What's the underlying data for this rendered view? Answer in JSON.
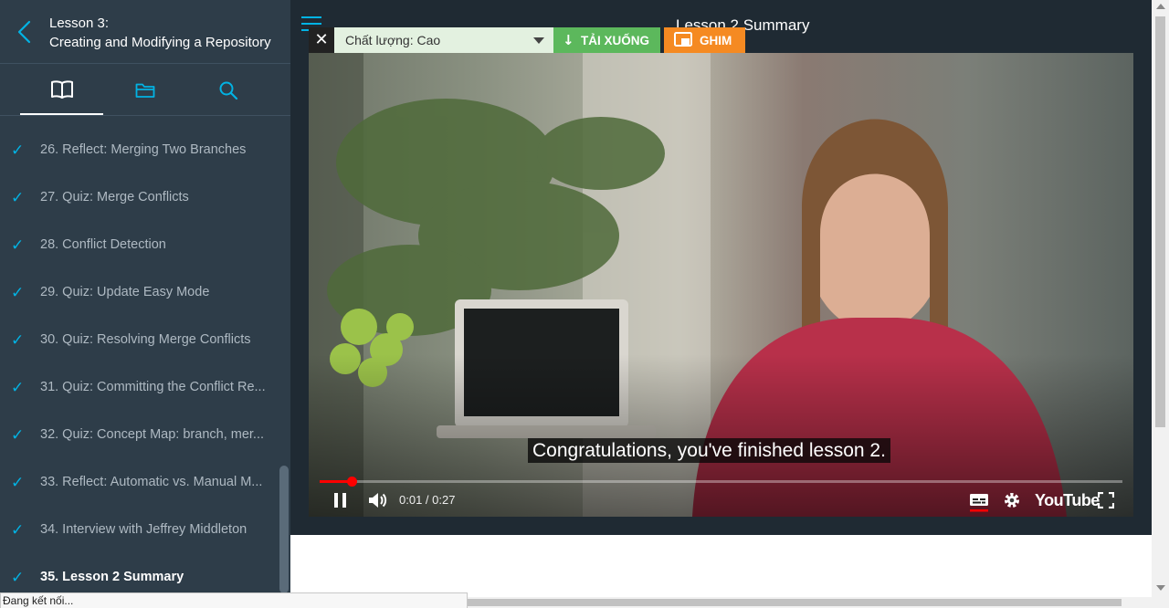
{
  "sidebar": {
    "lesson_number": "Lesson 3:",
    "lesson_title": "Creating and Modifying a Repository",
    "tabs": [
      {
        "icon": "book-icon",
        "active": true
      },
      {
        "icon": "folder-icon",
        "active": false
      },
      {
        "icon": "search-icon",
        "active": false
      }
    ],
    "concepts": [
      {
        "label": "26. Reflect: Merging Two Branches",
        "completed": true
      },
      {
        "label": "27. Quiz: Merge Conflicts",
        "completed": true
      },
      {
        "label": "28. Conflict Detection",
        "completed": true
      },
      {
        "label": "29. Quiz: Update Easy Mode",
        "completed": true
      },
      {
        "label": "30. Quiz: Resolving Merge Conflicts",
        "completed": true
      },
      {
        "label": "31. Quiz: Committing the Conflict Re...",
        "completed": true
      },
      {
        "label": "32. Quiz: Concept Map: branch, mer...",
        "completed": true
      },
      {
        "label": "33. Reflect: Automatic vs. Manual M...",
        "completed": true
      },
      {
        "label": "34. Interview with Jeffrey Middleton",
        "completed": true
      },
      {
        "label": "35. Lesson 2 Summary",
        "completed": true,
        "current": true
      }
    ],
    "check_glyph": "✓"
  },
  "header": {
    "video_title": "Lesson 2 Summary"
  },
  "toolbar": {
    "close_glyph": "✕",
    "quality_label": "Chất lượng: Cao",
    "download_glyph": "↓",
    "download_label": "TẢI XUỐNG",
    "pin_label": "GHIM"
  },
  "player": {
    "caption": "Congratulations, you've finished lesson 2.",
    "time": "0:01 / 0:27",
    "progress": 0.04,
    "logo": "YouTube",
    "icons": [
      "pause-icon",
      "volume-icon",
      "subtitles-icon",
      "settings-icon",
      "fullscreen-icon"
    ]
  },
  "browser": {
    "status_text": "Đang kết nối..."
  },
  "colors": {
    "sidebar_bg": "#2e3d49",
    "accent": "#02b3e4",
    "download_green": "#5cb85c",
    "pin_orange": "#f58a22",
    "progress_red": "#ff0000"
  }
}
